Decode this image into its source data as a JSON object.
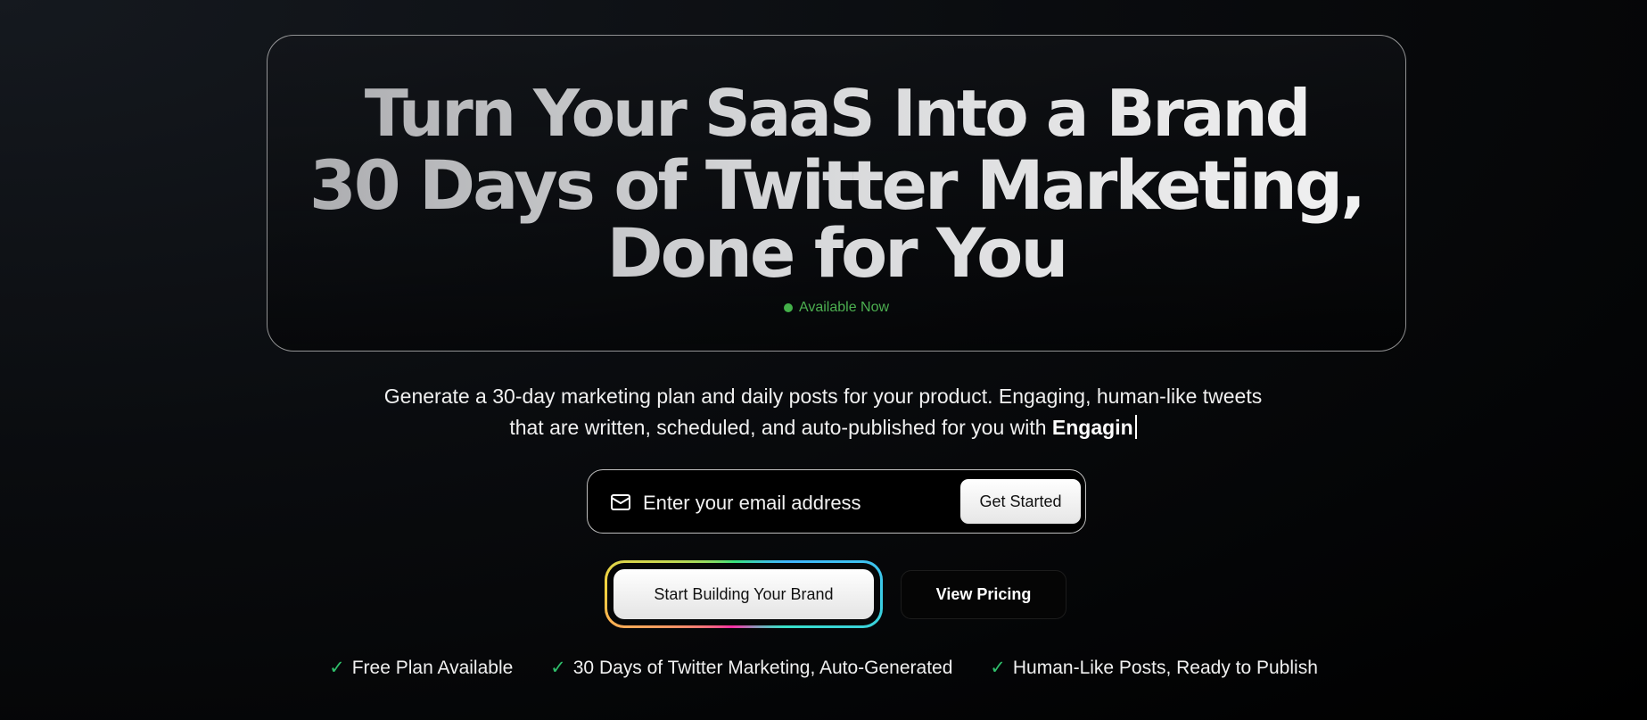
{
  "hero": {
    "headline_line1": "Turn Your SaaS Into a Brand",
    "headline_line2": "30 Days of Twitter Marketing,",
    "headline_line3": "Done for You",
    "status_text": "Available Now"
  },
  "subtitle": {
    "text": "Generate a 30-day marketing plan and daily posts for your product. Engaging, human-like tweets that are written, scheduled, and auto-published for you with ",
    "brand": "Engagin"
  },
  "email_form": {
    "placeholder": "Enter your email address",
    "value": "",
    "submit_label": "Get Started",
    "icon": "mail-icon"
  },
  "cta": {
    "primary_label": "Start Building Your Brand",
    "secondary_label": "View Pricing"
  },
  "features": [
    {
      "label": "Free Plan Available",
      "icon": "✓"
    },
    {
      "label": "30 Days of Twitter Marketing, Auto-Generated",
      "icon": "✓"
    },
    {
      "label": "Human-Like Posts, Ready to Publish",
      "icon": "✓"
    }
  ],
  "colors": {
    "status_green": "#43b049",
    "check_green": "#2fbf6b",
    "background": "#000000"
  }
}
